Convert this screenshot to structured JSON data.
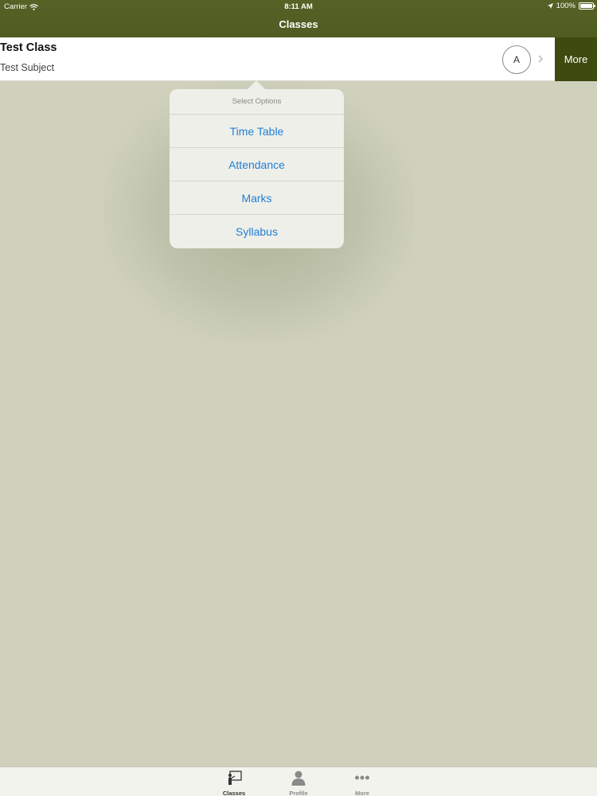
{
  "status_bar": {
    "carrier": "Carrier",
    "time": "8:11 AM",
    "battery": "100%",
    "battery_level": 1.0
  },
  "nav": {
    "title": "Classes"
  },
  "class_row": {
    "title": "Test Class",
    "subtitle": "Test Subject",
    "avatar_letter": "A",
    "more_label": "More"
  },
  "popover": {
    "header": "Select Options",
    "items": [
      {
        "label": "Time Table"
      },
      {
        "label": "Attendance"
      },
      {
        "label": "Marks"
      },
      {
        "label": "Syllabus"
      }
    ]
  },
  "tabbar": {
    "items": [
      {
        "label": "Classes",
        "icon": "teacher-board-icon",
        "selected": true
      },
      {
        "label": "Profile",
        "icon": "person-icon",
        "selected": false
      },
      {
        "label": "More",
        "icon": "ellipsis-icon",
        "selected": false
      }
    ]
  },
  "colors": {
    "nav_bg": "#556226",
    "more_button": "#3d4a10",
    "background": "#cfd1bd",
    "link_blue": "#1f7fd6",
    "tab_selected": "#333333",
    "tab_unselected": "#8a8a8a"
  }
}
